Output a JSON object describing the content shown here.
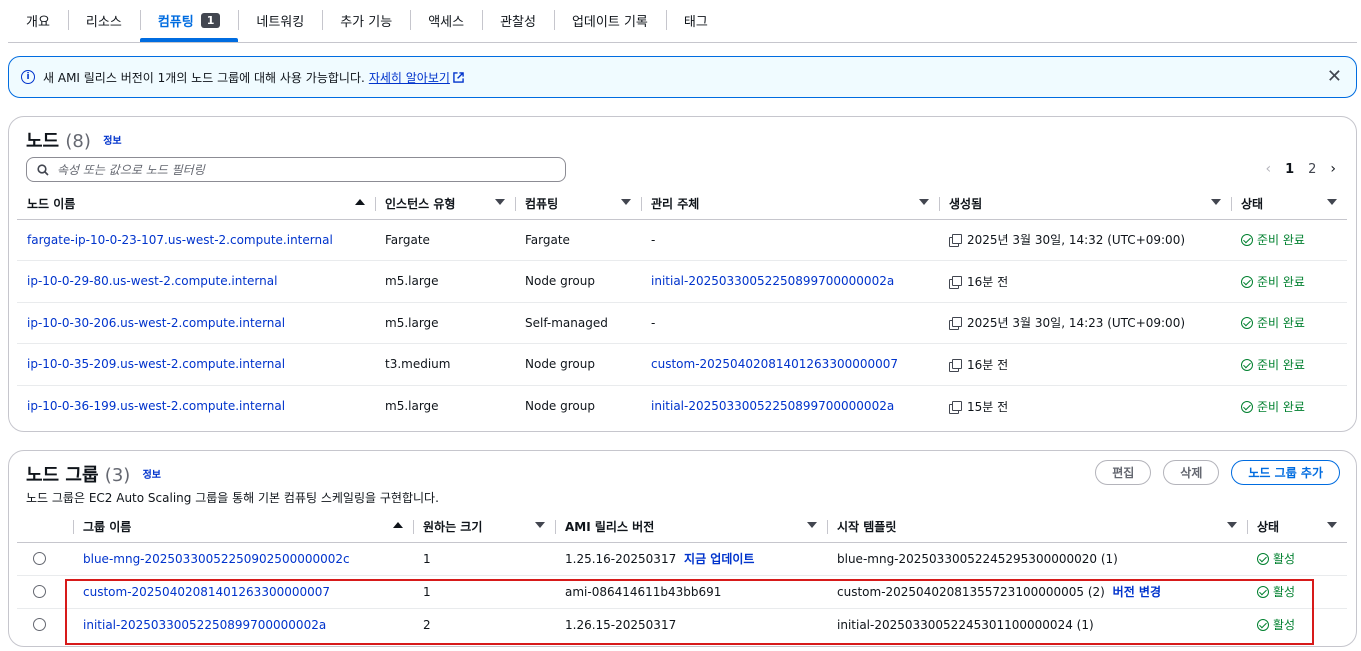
{
  "tabs": [
    {
      "label": "개요"
    },
    {
      "label": "리소스"
    },
    {
      "label": "컴퓨팅",
      "badge": "1",
      "active": true
    },
    {
      "label": "네트워킹"
    },
    {
      "label": "추가 기능"
    },
    {
      "label": "액세스"
    },
    {
      "label": "관찰성"
    },
    {
      "label": "업데이트 기록"
    },
    {
      "label": "태그"
    }
  ],
  "flash": {
    "message": "새 AMI 릴리스 버전이 1개의 노드 그룹에 대해 사용 가능합니다.",
    "link": "자세히 알아보기",
    "icon": "info-icon",
    "close_icon": "close-icon"
  },
  "nodes": {
    "title": "노드",
    "count": "(8)",
    "info": "정보",
    "search_placeholder": "속성 또는 값으로 노드 필터링",
    "pagination": {
      "current": "1",
      "next_page": "2"
    },
    "columns": [
      "노드 이름",
      "인스턴스 유형",
      "컴퓨팅",
      "관리 주체",
      "생성됨",
      "상태"
    ],
    "rows": [
      {
        "name": "fargate-ip-10-0-23-107.us-west-2.compute.internal",
        "instance_type": "Fargate",
        "compute": "Fargate",
        "managed_by": "-",
        "created": "2025년 3월 30일, 14:32 (UTC+09:00)",
        "status": "준비 완료"
      },
      {
        "name": "ip-10-0-29-80.us-west-2.compute.internal",
        "instance_type": "m5.large",
        "compute": "Node group",
        "managed_by": "initial-20250330052250899700000002a",
        "created": "16분 전",
        "status": "준비 완료"
      },
      {
        "name": "ip-10-0-30-206.us-west-2.compute.internal",
        "instance_type": "m5.large",
        "compute": "Self-managed",
        "managed_by": "-",
        "created": "2025년 3월 30일, 14:23 (UTC+09:00)",
        "status": "준비 완료"
      },
      {
        "name": "ip-10-0-35-209.us-west-2.compute.internal",
        "instance_type": "t3.medium",
        "compute": "Node group",
        "managed_by": "custom-20250402081401263300000007",
        "created": "16분 전",
        "status": "준비 완료"
      },
      {
        "name": "ip-10-0-36-199.us-west-2.compute.internal",
        "instance_type": "m5.large",
        "compute": "Node group",
        "managed_by": "initial-20250330052250899700000002a",
        "created": "15분 전",
        "status": "준비 완료"
      }
    ]
  },
  "node_groups": {
    "title": "노드 그룹",
    "count": "(3)",
    "info": "정보",
    "description": "노드 그룹은 EC2 Auto Scaling 그룹을 통해 기본 컴퓨팅 스케일링을 구현합니다.",
    "buttons": {
      "edit": "편집",
      "delete": "삭제",
      "add": "노드 그룹 추가"
    },
    "columns": [
      "그룹 이름",
      "원하는 크기",
      "AMI 릴리스 버전",
      "시작 템플릿",
      "상태"
    ],
    "rows": [
      {
        "name": "blue-mng-20250330052250902500000002c",
        "desired_size": "1",
        "ami_version": "1.25.16-20250317",
        "ami_action": "지금 업데이트",
        "launch_template": "blue-mng-20250330052245295300000020 (1)",
        "template_action": "",
        "status": "활성"
      },
      {
        "name": "custom-20250402081401263300000007",
        "desired_size": "1",
        "ami_version": "ami-086414611b43bb691",
        "ami_action": "",
        "launch_template": "custom-20250402081355723100000005 (2)",
        "template_action": "버전 변경",
        "status": "활성"
      },
      {
        "name": "initial-20250330052250899700000002a",
        "desired_size": "2",
        "ami_version": "1.26.15-20250317",
        "ami_action": "",
        "launch_template": "initial-20250330052245301100000024 (1)",
        "template_action": "",
        "status": "활성"
      }
    ]
  },
  "colors": {
    "accent": "#006ce0",
    "link": "#0033cc",
    "success": "#00802f",
    "highlight": "#d71a1a"
  }
}
